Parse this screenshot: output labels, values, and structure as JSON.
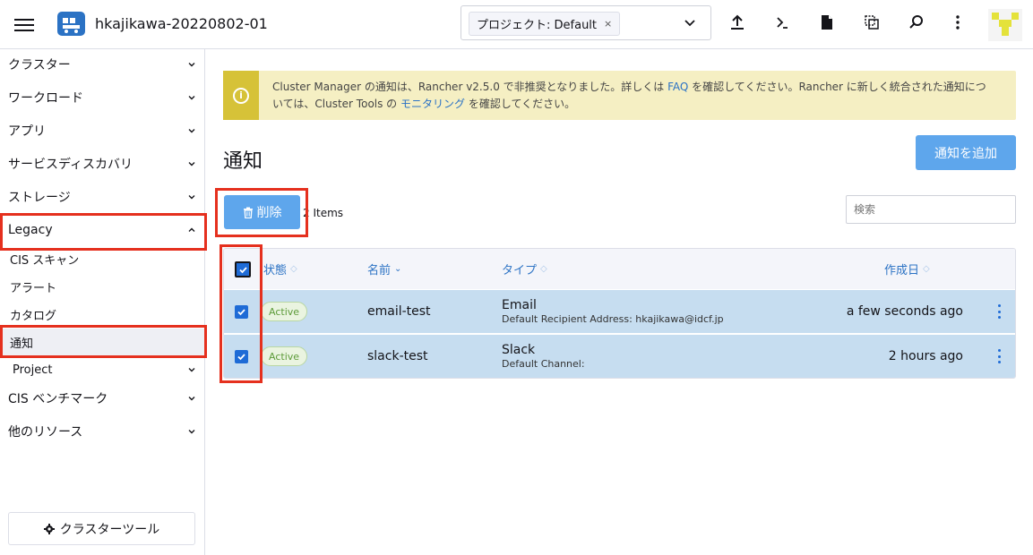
{
  "header": {
    "cluster_name": "hkajikawa-20220802-01",
    "namespace_chip": "プロジェクト: Default",
    "namespace_chip_close": "×"
  },
  "sidebar": {
    "groups": [
      {
        "label": "クラスター"
      },
      {
        "label": "ワークロード"
      },
      {
        "label": "アプリ"
      },
      {
        "label": "サービスディスカバリ"
      },
      {
        "label": "ストレージ"
      },
      {
        "label": "Legacy"
      },
      {
        "label": "CIS ベンチマーク"
      },
      {
        "label": "他のリソース"
      }
    ],
    "legacy_items": [
      {
        "label": "CIS スキャン"
      },
      {
        "label": "アラート"
      },
      {
        "label": "カタログ"
      },
      {
        "label": "通知"
      },
      {
        "label": "Project"
      }
    ],
    "cluster_tools_label": "クラスターツール"
  },
  "banner": {
    "text_1": "Cluster Manager の通知は、Rancher v2.5.0 で非推奨となりました。詳しくは ",
    "link_faq": "FAQ",
    "text_2": " を確認してください。Rancher に新しく統合された通知につ",
    "text_3": "いては、Cluster Tools の ",
    "link_monitoring": "モニタリング",
    "text_4": " を確認してください。"
  },
  "main": {
    "title": "通知",
    "add_button": "通知を追加",
    "delete_button": "削除",
    "selection_count": "2 Items",
    "search_placeholder": "検索",
    "columns": {
      "state": "状態",
      "name": "名前",
      "type": "タイプ",
      "created": "作成日"
    },
    "rows": [
      {
        "state": "Active",
        "name": "email-test",
        "type": "Email",
        "type_detail": "Default Recipient Address: hkajikawa@idcf.jp",
        "age": "a few seconds ago",
        "checked": true
      },
      {
        "state": "Active",
        "name": "slack-test",
        "type": "Slack",
        "type_detail": "Default Channel:",
        "age": "2 hours ago",
        "checked": true
      }
    ]
  },
  "colors": {
    "accent": "#5ea6ec",
    "link": "#2b72c4",
    "highlight_box": "#e5301e",
    "selected_row": "#c6ddf0",
    "banner_bg": "#f5efc3",
    "active_badge": "#5d9b3a"
  }
}
